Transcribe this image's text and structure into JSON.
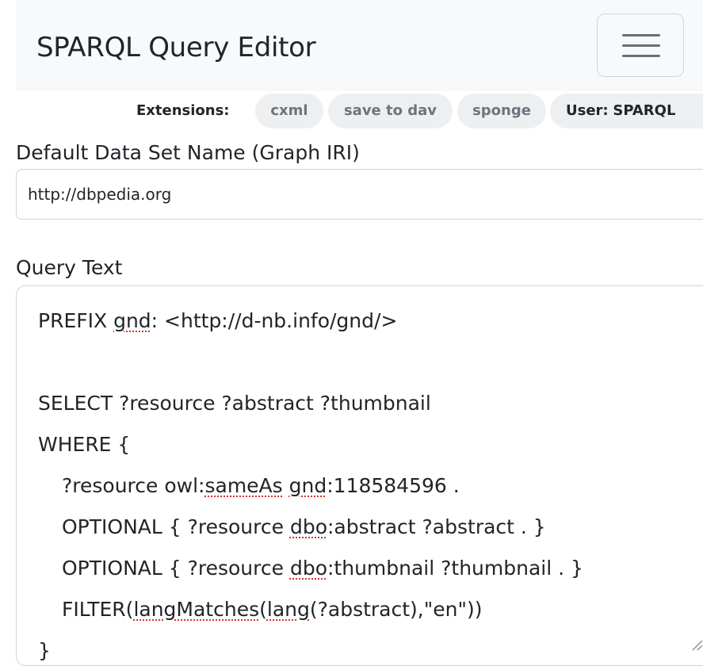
{
  "navbar": {
    "brand": "SPARQL Query Editor",
    "toggle_icon": "hamburger-menu-icon"
  },
  "extensions": {
    "label": "Extensions:",
    "items": [
      "cxml",
      "save to dav",
      "sponge"
    ]
  },
  "user": {
    "label": "User:",
    "name": "SPARQL"
  },
  "default_graph": {
    "label": "Default Data Set Name (Graph IRI)",
    "value": "http://dbpedia.org"
  },
  "query": {
    "label": "Query Text",
    "lines": [
      "PREFIX gnd: <http://d-nb.info/gnd/>",
      "",
      "SELECT ?resource ?abstract ?thumbnail",
      "WHERE {",
      "?resource owl:sameAs gnd:118584596 .",
      "OPTIONAL { ?resource dbo:abstract ?abstract . }",
      "OPTIONAL { ?resource dbo:thumbnail ?thumbnail . }",
      "FILTER(langMatches(lang(?abstract),\"en\"))",
      "}"
    ],
    "resize_icon": "resize-grip-icon"
  },
  "colors": {
    "navbar_bg": "#f8f9fa",
    "pill_bg": "#eeeff1",
    "muted_text": "#6c757d",
    "spellcheck_underline": "#d0342c"
  }
}
